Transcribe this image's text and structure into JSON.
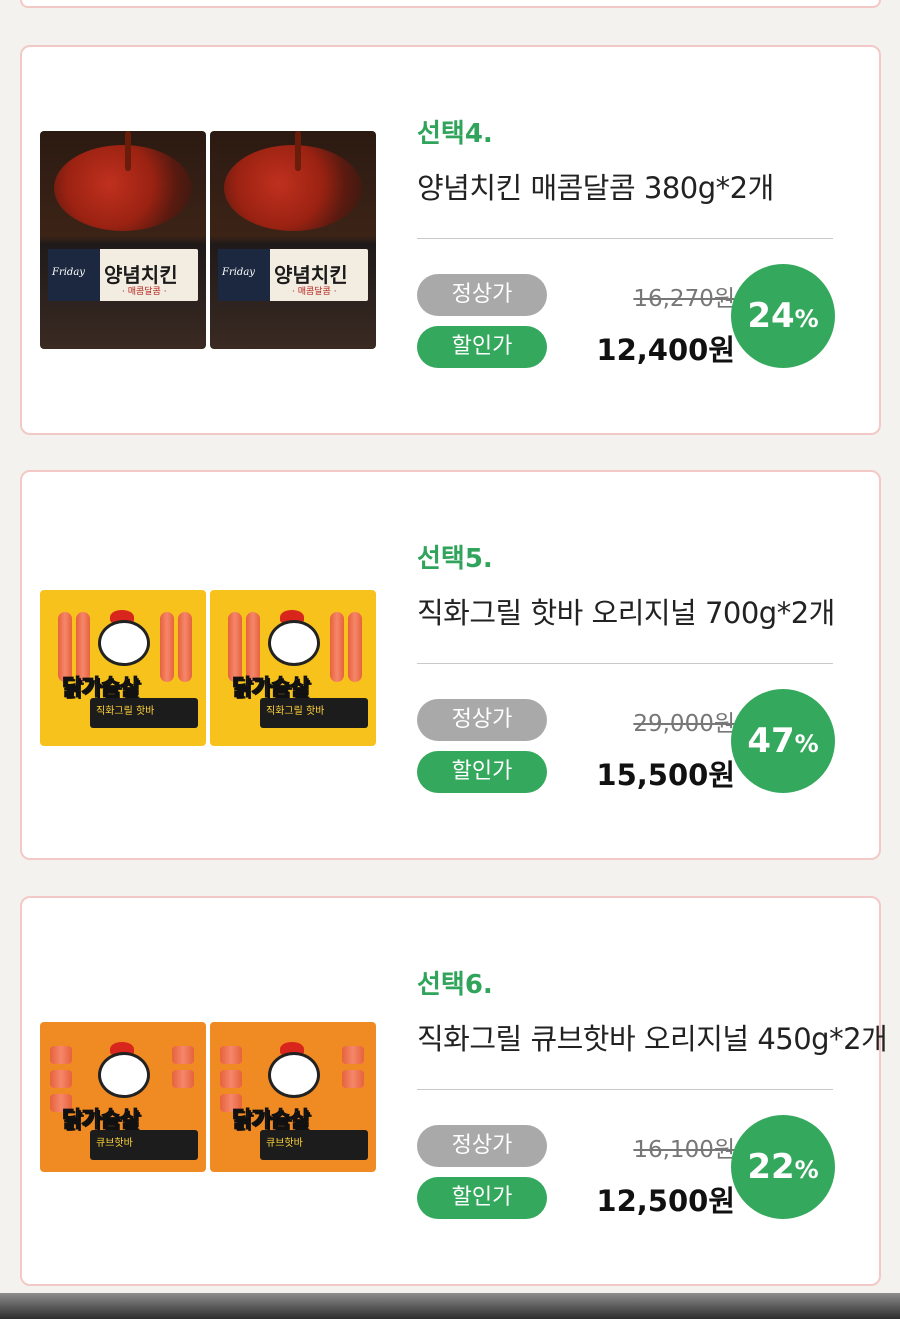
{
  "products": [
    {
      "option_label": "선택4.",
      "name": "양념치킨 매콤달콤 380g*2개",
      "regular_label": "정상가",
      "sale_label": "할인가",
      "regular_price": "16,270원",
      "sale_price": "12,400원",
      "discount_number": "24",
      "discount_unit": "%",
      "pack_title": "양념치킨",
      "pack_sub": "· 매콤달콤 ·",
      "pack_brand": "Friday"
    },
    {
      "option_label": "선택5.",
      "name": "직화그릴 핫바 오리지널 700g*2개",
      "regular_label": "정상가",
      "sale_label": "할인가",
      "regular_price": "29,000원",
      "sale_price": "15,500원",
      "discount_number": "47",
      "discount_unit": "%",
      "pack_title": "닭가슴살",
      "pack_sub": "직화그릴 핫바"
    },
    {
      "option_label": "선택6.",
      "name": "직화그릴 큐브핫바 오리지널 450g*2개",
      "regular_label": "정상가",
      "sale_label": "할인가",
      "regular_price": "16,100원",
      "sale_price": "12,500원",
      "discount_number": "22",
      "discount_unit": "%",
      "pack_title": "닭가슴살",
      "pack_sub": "큐브핫바"
    }
  ],
  "colors": {
    "accent_green": "#34a85c",
    "option_green": "#2fa45a",
    "regular_pill": "#a9a9a9",
    "card_border": "#f2c9c6"
  }
}
